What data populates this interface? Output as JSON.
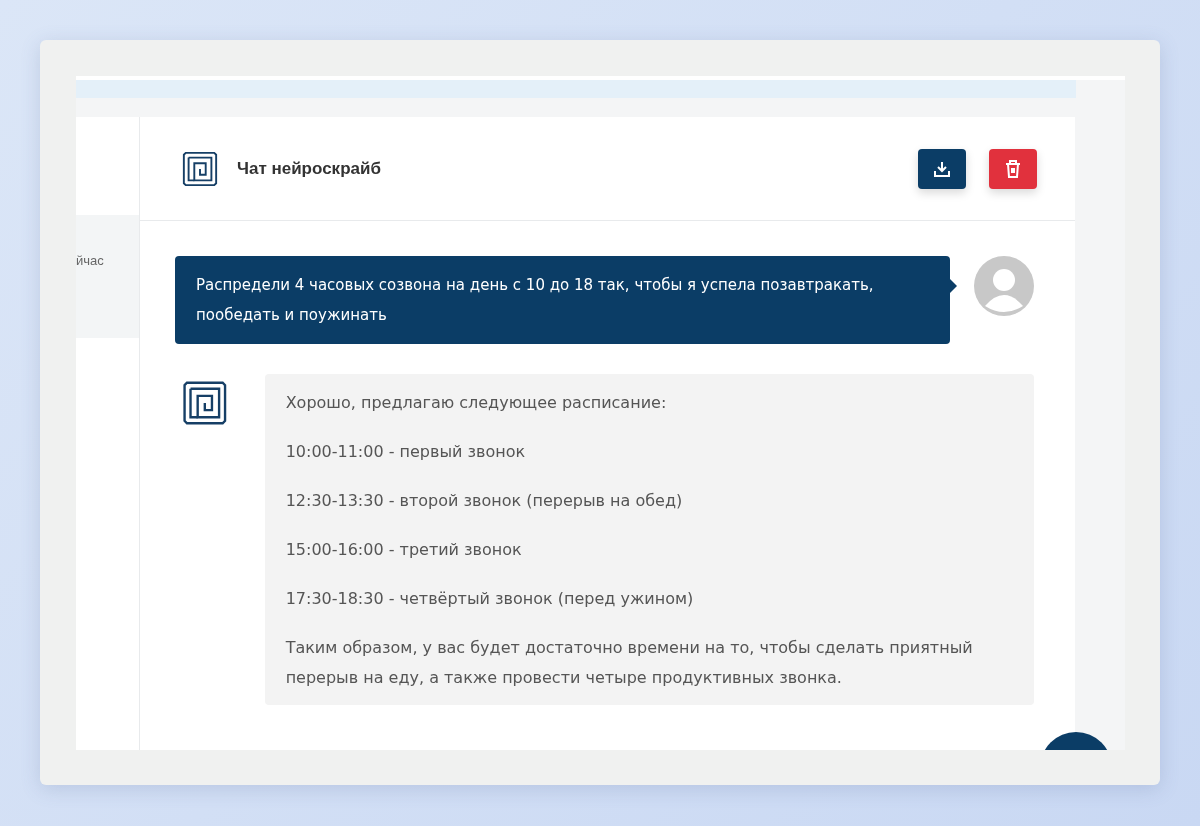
{
  "sidebar": {
    "items": [
      {
        "time": "йчас",
        "selected": true
      }
    ]
  },
  "chat": {
    "title": "Чат нейроскрайб",
    "actions": [
      {
        "kind": "download"
      },
      {
        "kind": "delete"
      }
    ],
    "messages": [
      {
        "kind": "user",
        "paragraphs": [
          "Распредели 4 часовых созвона на день с 10 до 18 так, чтобы я успела позавтракать, пообедать и поужинать"
        ]
      },
      {
        "kind": "bot",
        "paragraphs": [
          "Хорошо, предлагаю следующее расписание:",
          "10:00-11:00 - первый звонок",
          "12:30-13:30 - второй звонок (перерыв на обед)",
          "15:00-16:00 - третий звонок",
          "17:30-18:30 - четвёртый звонок (перед ужином)",
          "Таким образом, у вас будет достаточно времени на то, чтобы сделать приятный перерыв на еду, а также провести четыре продуктивных звонка."
        ]
      }
    ]
  }
}
